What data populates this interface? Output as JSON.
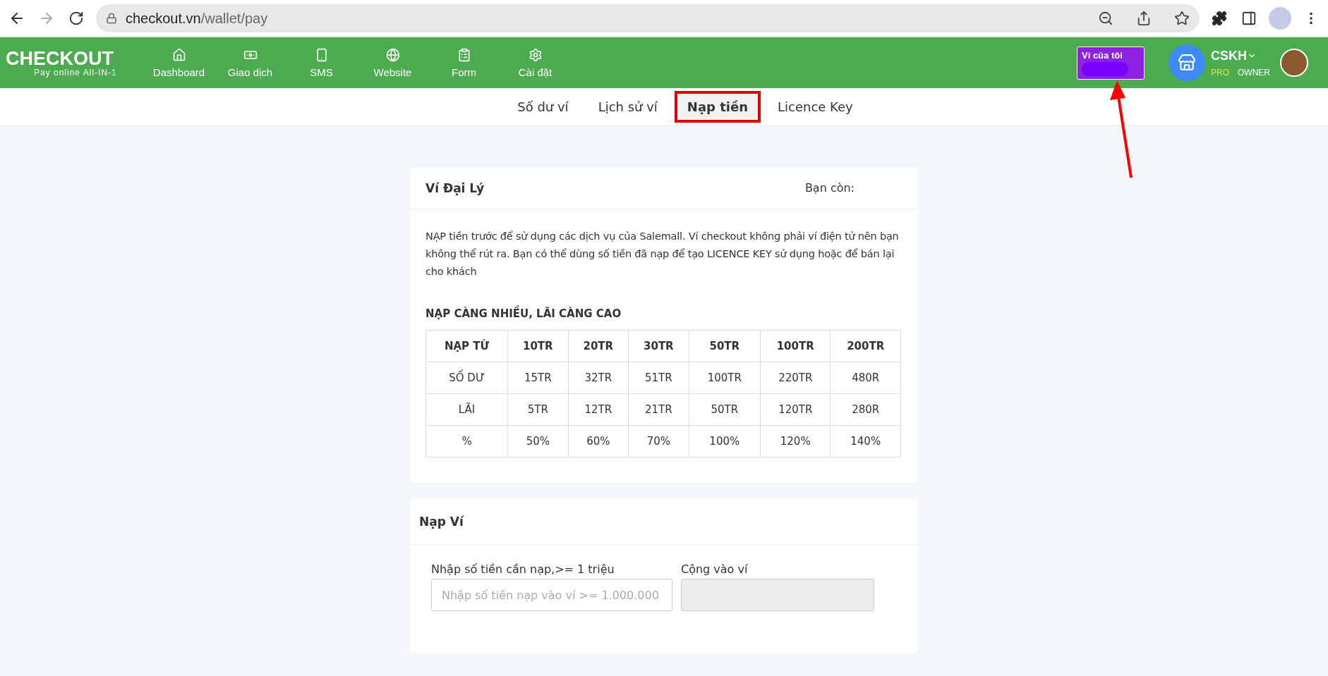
{
  "browser": {
    "url_host": "checkout.vn",
    "url_path": "/wallet/pay",
    "forward_disabled": true
  },
  "nav": {
    "logo_title": "CHECKOUT",
    "logo_tagline": "Pay online All-IN-1",
    "items": [
      {
        "label": "Dashboard"
      },
      {
        "label": "Giao dịch"
      },
      {
        "label": "SMS"
      },
      {
        "label": "Website"
      },
      {
        "label": "Form"
      },
      {
        "label": "Cài đặt"
      }
    ],
    "wallet_button": "Ví của tôi",
    "user_name": "CSKH",
    "plan": "PRO",
    "role": "OWNER"
  },
  "tabs": [
    {
      "label": "Số dư ví",
      "selected": false
    },
    {
      "label": "Lịch sử ví",
      "selected": false
    },
    {
      "label": "Nạp tiền",
      "selected": true
    },
    {
      "label": "Licence Key",
      "selected": false
    }
  ],
  "agent_wallet": {
    "title": "Ví Đại Lý",
    "balance_label": "Bạn còn:",
    "description": "NẠP tiền trước để sử dụng các dịch vụ của Salemall. Ví checkout không phải ví điện tử nên bạn không thể rút ra. Bạn có thể dùng số tiền đã nạp để tạo LICENCE KEY sử dụng hoặc để bán lại cho khách",
    "table_title": "NẠP CÀNG NHIỀU, LÃI CÀNG CAO",
    "columns": [
      "NẠP TỪ",
      "10TR",
      "20TR",
      "30TR",
      "50TR",
      "100TR",
      "200TR"
    ],
    "rows": [
      [
        "SỐ DƯ",
        "15TR",
        "32TR",
        "51TR",
        "100TR",
        "220TR",
        "480R"
      ],
      [
        "LÃI",
        "5TR",
        "12TR",
        "21TR",
        "50TR",
        "120TR",
        "280R"
      ],
      [
        "%",
        "50%",
        "60%",
        "70%",
        "100%",
        "120%",
        "140%"
      ]
    ]
  },
  "top_up": {
    "title": "Nạp Ví",
    "amount_label": "Nhập số tiền cần nạp,>= 1 triệu",
    "amount_placeholder": "Nhập số tiền nạp vào ví >= 1.000.000",
    "credit_label": "Cộng vào ví",
    "credit_disabled": true
  }
}
